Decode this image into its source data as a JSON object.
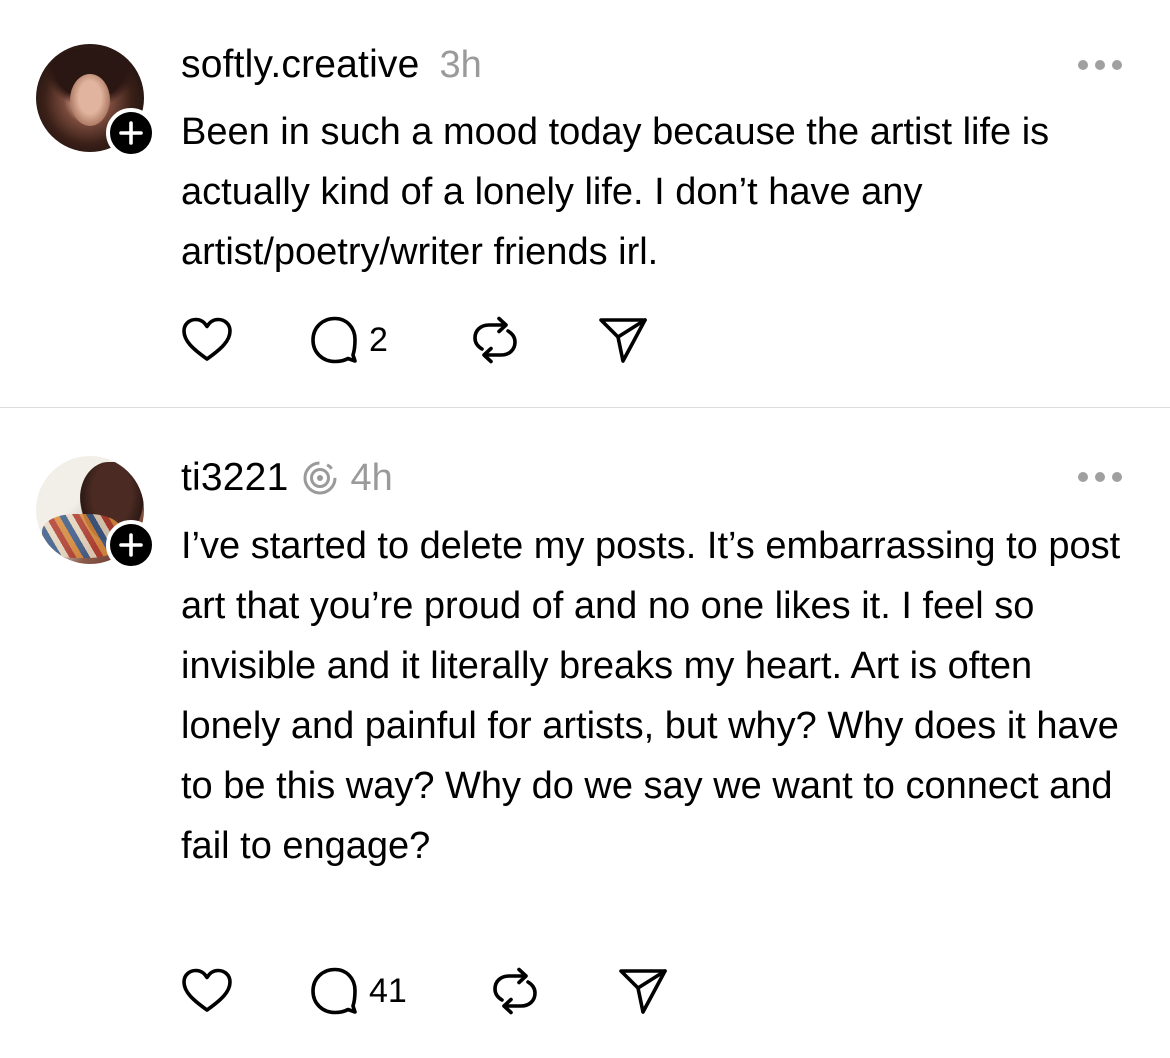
{
  "posts": [
    {
      "username": "softly.creative",
      "timestamp": "3h",
      "text": "Been in such a mood today because the artist life is actually kind of a lonely life. I don’t have any artist/poetry/writer friends irl.",
      "reply_count": "2",
      "avatar_icon": "profile-photo",
      "verified": false
    },
    {
      "username": "ti3221",
      "timestamp": "4h",
      "text": "I’ve started to delete my posts. It’s embarrassing to post art that you’re proud of and no one likes it. I feel so invisible and it literally breaks my heart. Art is often lonely and painful for artists, but why? Why does it have to be this way? Why do we say we want to connect and fail to engage?",
      "reply_count": "41",
      "avatar_icon": "profile-photo",
      "verified": true
    }
  ],
  "icons": {
    "follow": "plus-icon",
    "more": "more-horizontal-icon",
    "like": "heart-icon",
    "reply": "comment-icon",
    "repost": "repost-icon",
    "share": "send-icon",
    "badge": "threads-badge-icon"
  },
  "colors": {
    "text": "#000000",
    "muted": "#9a9a9a",
    "divider": "#dcdcdc",
    "background": "#ffffff"
  }
}
